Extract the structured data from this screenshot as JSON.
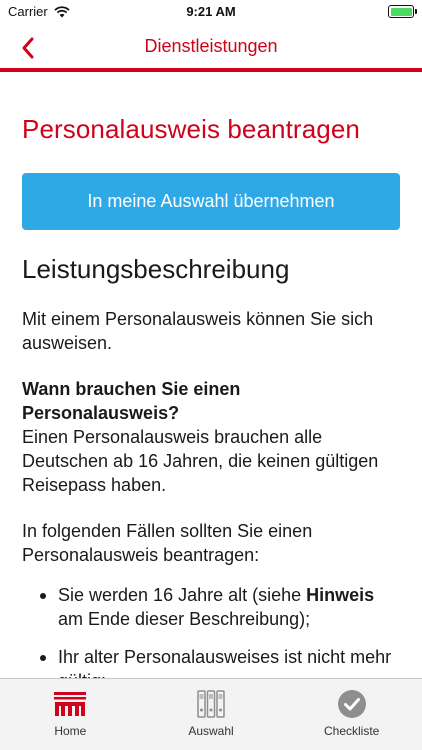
{
  "status_bar": {
    "carrier": "Carrier",
    "time": "9:21 AM",
    "battery_level": 1.0
  },
  "nav": {
    "title": "Dienstleistungen"
  },
  "content": {
    "title": "Personalausweis beantragen",
    "cta_label": "In meine Auswahl übernehmen",
    "section_title": "Leistungsbeschreibung",
    "p1": "Mit einem Personalausweis können Sie sich ausweisen.",
    "p2_heading": "Wann brauchen Sie einen Personalausweis?",
    "p2_body": "Einen Personalausweis brauchen alle Deutschen ab 16 Jahren, die keinen gültigen Reisepass haben.",
    "p3": "In folgenden Fällen sollten Sie einen Personalausweis beantragen:",
    "list": [
      {
        "before": "Sie werden 16 Jahre alt (siehe ",
        "bold": "Hinweis",
        "after": " am Ende dieser Beschreibung);"
      },
      {
        "text": "Ihr alter Personalausweises ist nicht mehr gültig;"
      }
    ]
  },
  "tabs": [
    {
      "label": "Home",
      "icon": "home-logo-icon"
    },
    {
      "label": "Auswahl",
      "icon": "binders-icon"
    },
    {
      "label": "Checkliste",
      "icon": "checkmark-circle-icon"
    }
  ],
  "colors": {
    "accent": "#d0021b",
    "button": "#2fa9e6",
    "tabbar": "#f3f3f3"
  }
}
